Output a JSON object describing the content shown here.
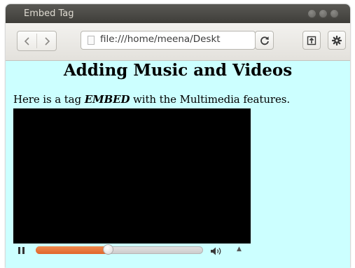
{
  "window": {
    "title": "Embed Tag"
  },
  "toolbar": {
    "url": "file:///home/meena/Deskt"
  },
  "page": {
    "heading": "Adding Music and Videos",
    "text_before": "Here is a tag ",
    "text_emphasis": "EMBED",
    "text_after": " with the Multimedia features."
  },
  "media_player": {
    "progress": 0.43
  },
  "colors": {
    "page_background": "#ccffff",
    "progress_fill": "#e0662b",
    "titlebar": "#3e3d39"
  },
  "icons": [
    "back-icon",
    "forward-icon",
    "file-icon",
    "reload-icon",
    "bookmark-page-icon",
    "gear-icon",
    "pause-icon",
    "volume-icon",
    "menu-arrow-icon"
  ]
}
